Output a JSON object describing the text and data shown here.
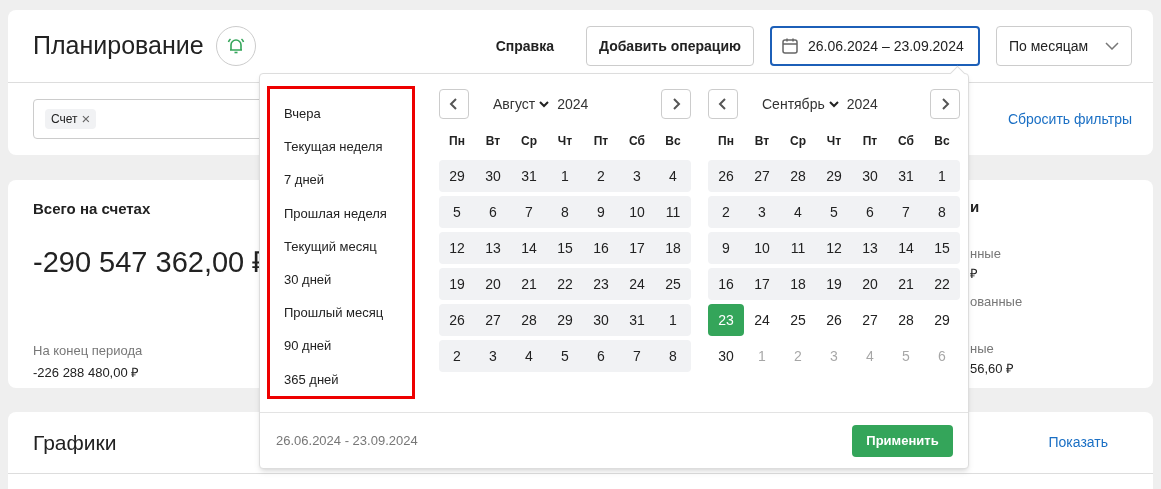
{
  "header": {
    "title": "Планирование",
    "help": "Справка",
    "add_button": "Добавить операцию",
    "date_range": "26.06.2024 – 23.09.2024",
    "grouping": "По месяцам"
  },
  "filters": {
    "chips": [
      "Счет"
    ],
    "chip_remove": "×",
    "reset": "Сбросить фильтры"
  },
  "summary": {
    "title": "Всего на счетах",
    "amount": "-290 547 362,00 ₽",
    "end_label": "На конец периода",
    "end_value": "-226 288 480,00 ₽",
    "right_fragments": [
      {
        "kind": "heading",
        "text": "и"
      },
      {
        "kind": "label",
        "text": "нные"
      },
      {
        "kind": "value",
        "text": "₽"
      },
      {
        "kind": "label",
        "text": "ованные"
      },
      {
        "kind": "gap"
      },
      {
        "kind": "label",
        "text": "ные"
      },
      {
        "kind": "value",
        "text": "56,60 ₽"
      }
    ]
  },
  "charts": {
    "title": "Графики",
    "show": "Показать"
  },
  "date_picker": {
    "presets": [
      "Вчера",
      "Текущая неделя",
      "7 дней",
      "Прошлая неделя",
      "Текущий месяц",
      "30 дней",
      "Прошлый месяц",
      "90 дней",
      "365 дней"
    ],
    "months": [
      {
        "month": "Август",
        "year": "2024",
        "weekdays": [
          "Пн",
          "Вт",
          "Ср",
          "Чт",
          "Пт",
          "Сб",
          "Вс"
        ],
        "weeks": [
          {
            "in_range": true,
            "days": [
              {
                "d": "29",
                "muted": false,
                "selected": false
              },
              {
                "d": "30",
                "muted": false,
                "selected": false
              },
              {
                "d": "31",
                "muted": false,
                "selected": false
              },
              {
                "d": "1",
                "muted": false,
                "selected": false
              },
              {
                "d": "2",
                "muted": false,
                "selected": false
              },
              {
                "d": "3",
                "muted": false,
                "selected": false
              },
              {
                "d": "4",
                "muted": false,
                "selected": false
              }
            ]
          },
          {
            "in_range": true,
            "days": [
              {
                "d": "5",
                "muted": false,
                "selected": false
              },
              {
                "d": "6",
                "muted": false,
                "selected": false
              },
              {
                "d": "7",
                "muted": false,
                "selected": false
              },
              {
                "d": "8",
                "muted": false,
                "selected": false
              },
              {
                "d": "9",
                "muted": false,
                "selected": false
              },
              {
                "d": "10",
                "muted": false,
                "selected": false
              },
              {
                "d": "11",
                "muted": false,
                "selected": false
              }
            ]
          },
          {
            "in_range": true,
            "days": [
              {
                "d": "12",
                "muted": false,
                "selected": false
              },
              {
                "d": "13",
                "muted": false,
                "selected": false
              },
              {
                "d": "14",
                "muted": false,
                "selected": false
              },
              {
                "d": "15",
                "muted": false,
                "selected": false
              },
              {
                "d": "16",
                "muted": false,
                "selected": false
              },
              {
                "d": "17",
                "muted": false,
                "selected": false
              },
              {
                "d": "18",
                "muted": false,
                "selected": false
              }
            ]
          },
          {
            "in_range": true,
            "days": [
              {
                "d": "19",
                "muted": false,
                "selected": false
              },
              {
                "d": "20",
                "muted": false,
                "selected": false
              },
              {
                "d": "21",
                "muted": false,
                "selected": false
              },
              {
                "d": "22",
                "muted": false,
                "selected": false
              },
              {
                "d": "23",
                "muted": false,
                "selected": false
              },
              {
                "d": "24",
                "muted": false,
                "selected": false
              },
              {
                "d": "25",
                "muted": false,
                "selected": false
              }
            ]
          },
          {
            "in_range": true,
            "days": [
              {
                "d": "26",
                "muted": false,
                "selected": false
              },
              {
                "d": "27",
                "muted": false,
                "selected": false
              },
              {
                "d": "28",
                "muted": false,
                "selected": false
              },
              {
                "d": "29",
                "muted": false,
                "selected": false
              },
              {
                "d": "30",
                "muted": false,
                "selected": false
              },
              {
                "d": "31",
                "muted": false,
                "selected": false
              },
              {
                "d": "1",
                "muted": false,
                "selected": false
              }
            ]
          },
          {
            "in_range": true,
            "days": [
              {
                "d": "2",
                "muted": false,
                "selected": false
              },
              {
                "d": "3",
                "muted": false,
                "selected": false
              },
              {
                "d": "4",
                "muted": false,
                "selected": false
              },
              {
                "d": "5",
                "muted": false,
                "selected": false
              },
              {
                "d": "6",
                "muted": false,
                "selected": false
              },
              {
                "d": "7",
                "muted": false,
                "selected": false
              },
              {
                "d": "8",
                "muted": false,
                "selected": false
              }
            ]
          }
        ]
      },
      {
        "month": "Сентябрь",
        "year": "2024",
        "weekdays": [
          "Пн",
          "Вт",
          "Ср",
          "Чт",
          "Пт",
          "Сб",
          "Вс"
        ],
        "weeks": [
          {
            "in_range": true,
            "days": [
              {
                "d": "26",
                "muted": false,
                "selected": false
              },
              {
                "d": "27",
                "muted": false,
                "selected": false
              },
              {
                "d": "28",
                "muted": false,
                "selected": false
              },
              {
                "d": "29",
                "muted": false,
                "selected": false
              },
              {
                "d": "30",
                "muted": false,
                "selected": false
              },
              {
                "d": "31",
                "muted": false,
                "selected": false
              },
              {
                "d": "1",
                "muted": false,
                "selected": false
              }
            ]
          },
          {
            "in_range": true,
            "days": [
              {
                "d": "2",
                "muted": false,
                "selected": false
              },
              {
                "d": "3",
                "muted": false,
                "selected": false
              },
              {
                "d": "4",
                "muted": false,
                "selected": false
              },
              {
                "d": "5",
                "muted": false,
                "selected": false
              },
              {
                "d": "6",
                "muted": false,
                "selected": false
              },
              {
                "d": "7",
                "muted": false,
                "selected": false
              },
              {
                "d": "8",
                "muted": false,
                "selected": false
              }
            ]
          },
          {
            "in_range": true,
            "days": [
              {
                "d": "9",
                "muted": false,
                "selected": false
              },
              {
                "d": "10",
                "muted": false,
                "selected": false
              },
              {
                "d": "11",
                "muted": false,
                "selected": false
              },
              {
                "d": "12",
                "muted": false,
                "selected": false
              },
              {
                "d": "13",
                "muted": false,
                "selected": false
              },
              {
                "d": "14",
                "muted": false,
                "selected": false
              },
              {
                "d": "15",
                "muted": false,
                "selected": false
              }
            ]
          },
          {
            "in_range": true,
            "days": [
              {
                "d": "16",
                "muted": false,
                "selected": false
              },
              {
                "d": "17",
                "muted": false,
                "selected": false
              },
              {
                "d": "18",
                "muted": false,
                "selected": false
              },
              {
                "d": "19",
                "muted": false,
                "selected": false
              },
              {
                "d": "20",
                "muted": false,
                "selected": false
              },
              {
                "d": "21",
                "muted": false,
                "selected": false
              },
              {
                "d": "22",
                "muted": false,
                "selected": false
              }
            ]
          },
          {
            "in_range": false,
            "days": [
              {
                "d": "23",
                "muted": false,
                "selected": true
              },
              {
                "d": "24",
                "muted": false,
                "selected": false
              },
              {
                "d": "25",
                "muted": false,
                "selected": false
              },
              {
                "d": "26",
                "muted": false,
                "selected": false
              },
              {
                "d": "27",
                "muted": false,
                "selected": false
              },
              {
                "d": "28",
                "muted": false,
                "selected": false
              },
              {
                "d": "29",
                "muted": false,
                "selected": false
              }
            ]
          },
          {
            "in_range": false,
            "days": [
              {
                "d": "30",
                "muted": false,
                "selected": false
              },
              {
                "d": "1",
                "muted": true,
                "selected": false
              },
              {
                "d": "2",
                "muted": true,
                "selected": false
              },
              {
                "d": "3",
                "muted": true,
                "selected": false
              },
              {
                "d": "4",
                "muted": true,
                "selected": false
              },
              {
                "d": "5",
                "muted": true,
                "selected": false
              },
              {
                "d": "6",
                "muted": true,
                "selected": false
              }
            ]
          }
        ]
      }
    ],
    "footer_range": "26.06.2024 - 23.09.2024",
    "apply": "Применить"
  }
}
